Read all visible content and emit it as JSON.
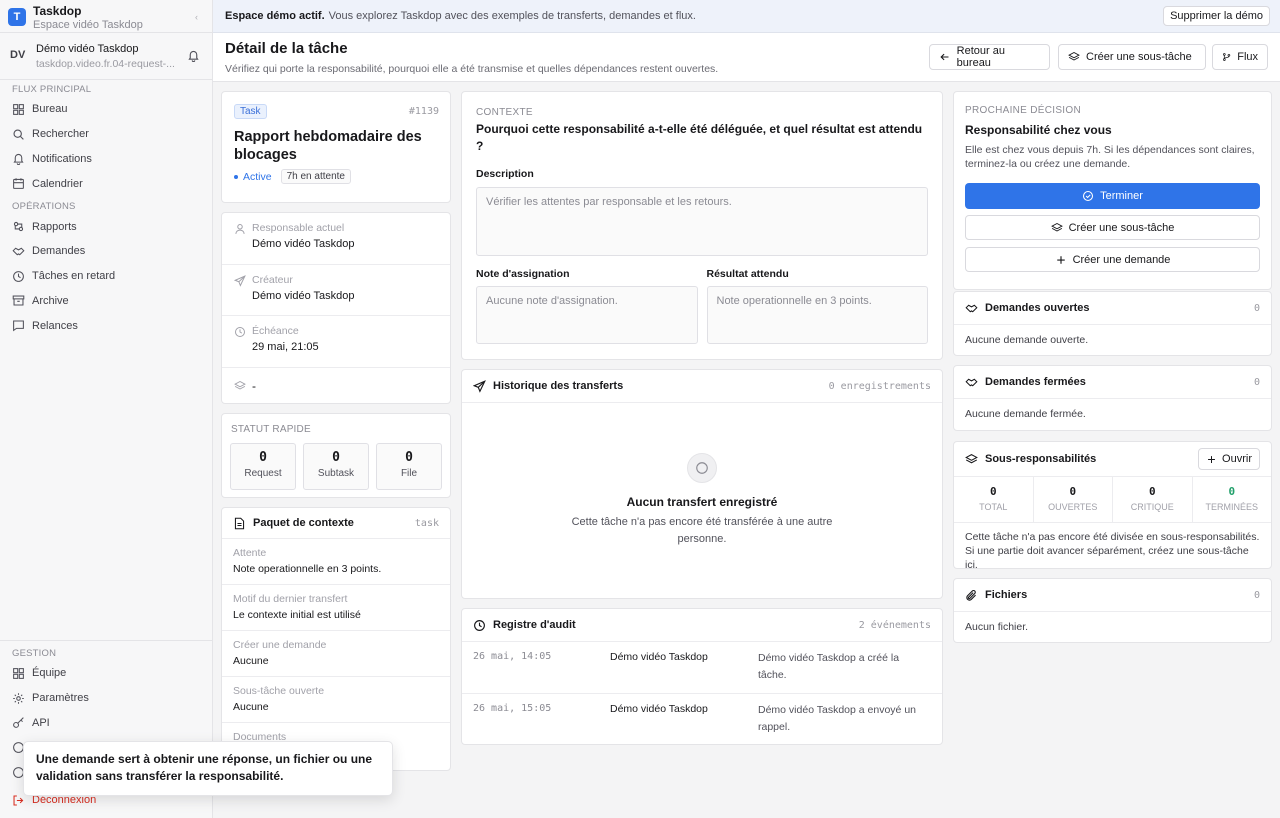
{
  "brand": {
    "initial": "T",
    "name": "Taskdop",
    "subtitle": "Espace vidéo Taskdop"
  },
  "user": {
    "initials": "DV",
    "name": "Démo vidéo Taskdop",
    "email": "taskdop.video.fr.04-request-..."
  },
  "nav": {
    "section_main": "FLUX PRINCIPAL",
    "main": [
      {
        "label": "Bureau",
        "icon": "grid-icon"
      },
      {
        "label": "Rechercher",
        "icon": "search-icon"
      },
      {
        "label": "Notifications",
        "icon": "bell-icon"
      },
      {
        "label": "Calendrier",
        "icon": "calendar-icon"
      }
    ],
    "section_ops": "OPÉRATIONS",
    "ops": [
      {
        "label": "Rapports",
        "icon": "rapports-icon"
      },
      {
        "label": "Demandes",
        "icon": "handshake-icon"
      },
      {
        "label": "Tâches en retard",
        "icon": "clock-icon"
      },
      {
        "label": "Archive",
        "icon": "archive-icon"
      },
      {
        "label": "Relances",
        "icon": "message-icon"
      }
    ],
    "section_mgmt": "GESTION",
    "mgmt": [
      {
        "label": "Équipe",
        "icon": "team-icon"
      },
      {
        "label": "Paramètres",
        "icon": "gear-icon"
      },
      {
        "label": "API",
        "icon": "key-icon"
      }
    ],
    "logout": "Déconnexion"
  },
  "banner": {
    "strong": "Espace démo actif.",
    "text": "Vous explorez Taskdop avec des exemples de transferts, demandes et flux.",
    "button": "Supprimer la démo"
  },
  "header": {
    "title": "Détail de la tâche",
    "subtitle": "Vérifiez qui porte la responsabilité, pourquoi elle a été transmise et quelles dépendances restent ouvertes.",
    "btn_back": "Retour au bureau",
    "btn_subtask": "Créer une sous-tâche",
    "btn_flow": "Flux"
  },
  "task": {
    "type": "Task",
    "id": "#1139",
    "title": "Rapport hebdomadaire des blocages",
    "status": "Active",
    "waiting": "7h en attente"
  },
  "meta": [
    {
      "label": "Responsable actuel",
      "value": "Démo vidéo Taskdop",
      "icon": "user-icon"
    },
    {
      "label": "Créateur",
      "value": "Démo vidéo Taskdop",
      "icon": "send-icon"
    },
    {
      "label": "Échéance",
      "value": "29 mai, 21:05",
      "icon": "clock-icon"
    },
    {
      "label": "",
      "value": "-",
      "icon": "layers-icon"
    }
  ],
  "quick_status": {
    "title": "STATUT RAPIDE",
    "items": [
      {
        "num": "0",
        "label": "Request"
      },
      {
        "num": "0",
        "label": "Subtask"
      },
      {
        "num": "0",
        "label": "File"
      }
    ]
  },
  "context_pack": {
    "title": "Paquet de contexte",
    "tag": "task",
    "rows": [
      {
        "label": "Attente",
        "value": "Note operationnelle en 3 points."
      },
      {
        "label": "Motif du dernier transfert",
        "value": "Le contexte initial est utilisé"
      },
      {
        "label": "Créer une demande",
        "value": "Aucune"
      },
      {
        "label": "Sous-tâche ouverte",
        "value": "Aucune"
      },
      {
        "label": "Documents",
        "value": ""
      }
    ]
  },
  "context": {
    "section": "CONTEXTE",
    "question": "Pourquoi cette responsabilité a-t-elle été déléguée, et quel résultat est attendu ?",
    "desc_label": "Description",
    "desc_value": "Vérifier les attentes par responsable et les retours.",
    "note_label": "Note d'assignation",
    "note_value": "Aucune note d'assignation.",
    "result_label": "Résultat attendu",
    "result_value": "Note operationnelle en 3 points."
  },
  "transfers": {
    "title": "Historique des transferts",
    "count": "0 enregistrements",
    "empty_title": "Aucun transfert enregistré",
    "empty_sub": "Cette tâche n'a pas encore été transférée à une autre personne."
  },
  "audit": {
    "title": "Registre d'audit",
    "count": "2 événements",
    "rows": [
      {
        "date": "26 mai, 14:05",
        "actor": "Démo vidéo Taskdop",
        "desc": "Démo vidéo Taskdop a créé la tâche."
      },
      {
        "date": "26 mai, 15:05",
        "actor": "Démo vidéo Taskdop",
        "desc": "Démo vidéo Taskdop a envoyé un rappel."
      }
    ]
  },
  "decision": {
    "section": "PROCHAINE DÉCISION",
    "title": "Responsabilité chez vous",
    "text": "Elle est chez vous depuis 7h. Si les dépendances sont claires, terminez-la ou créez une demande.",
    "btn_finish": "Terminer",
    "btn_subtask": "Créer une sous-tâche",
    "btn_request": "Créer une demande"
  },
  "open_requests": {
    "title": "Demandes ouvertes",
    "count": "0",
    "empty": "Aucune demande ouverte."
  },
  "closed_requests": {
    "title": "Demandes fermées",
    "count": "0",
    "empty": "Aucune demande fermée."
  },
  "sub_resp": {
    "title": "Sous-responsabilités",
    "btn": "Ouvrir",
    "stats": [
      {
        "num": "0",
        "label": "TOTAL"
      },
      {
        "num": "0",
        "label": "OUVERTES"
      },
      {
        "num": "0",
        "label": "CRITIQUE"
      },
      {
        "num": "0",
        "label": "TERMINÉES"
      }
    ],
    "text": "Cette tâche n'a pas encore été divisée en sous-responsabilités. Si une partie doit avancer séparément, créez une sous-tâche ici."
  },
  "files": {
    "title": "Fichiers",
    "count": "0",
    "empty": "Aucun fichier."
  },
  "tooltip": {
    "text": "Une demande sert à obtenir une réponse, un fichier ou une validation sans transférer la responsabilité."
  },
  "colors": {
    "accent": "#2f74e8",
    "danger": "#d92d20",
    "success": "#22a06b"
  }
}
